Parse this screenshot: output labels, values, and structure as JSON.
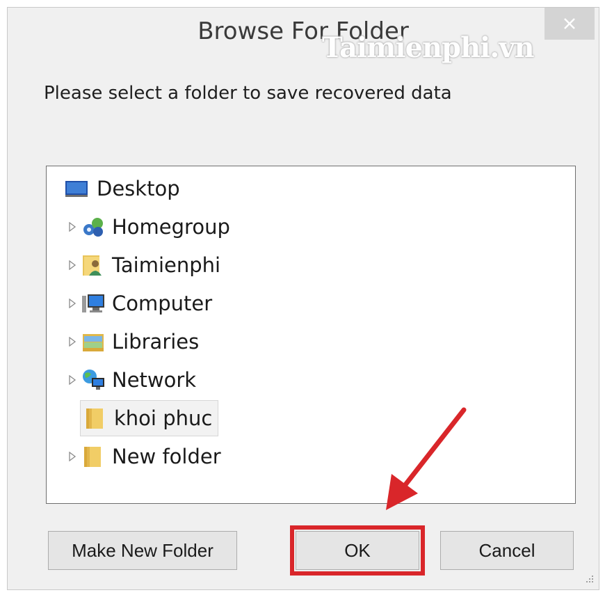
{
  "dialog": {
    "title": "Browse For Folder",
    "watermark": "Taimienphi.vn",
    "prompt": "Please select a folder to save recovered data"
  },
  "tree": {
    "items": [
      {
        "label": "Desktop",
        "icon": "desktop-icon",
        "expandable": false,
        "selected": false
      },
      {
        "label": "Homegroup",
        "icon": "homegroup-icon",
        "expandable": true,
        "selected": false
      },
      {
        "label": "Taimienphi",
        "icon": "user-folder-icon",
        "expandable": true,
        "selected": false
      },
      {
        "label": "Computer",
        "icon": "computer-icon",
        "expandable": true,
        "selected": false
      },
      {
        "label": "Libraries",
        "icon": "libraries-icon",
        "expandable": true,
        "selected": false
      },
      {
        "label": "Network",
        "icon": "network-icon",
        "expandable": true,
        "selected": false
      },
      {
        "label": "khoi phuc",
        "icon": "folder-icon",
        "expandable": false,
        "selected": true
      },
      {
        "label": "New folder",
        "icon": "folder-icon",
        "expandable": true,
        "selected": false
      }
    ]
  },
  "buttons": {
    "make_new_folder": "Make New Folder",
    "ok": "OK",
    "cancel": "Cancel"
  },
  "colors": {
    "highlight": "#d9262a",
    "dialog_bg": "#f0f0f0"
  }
}
